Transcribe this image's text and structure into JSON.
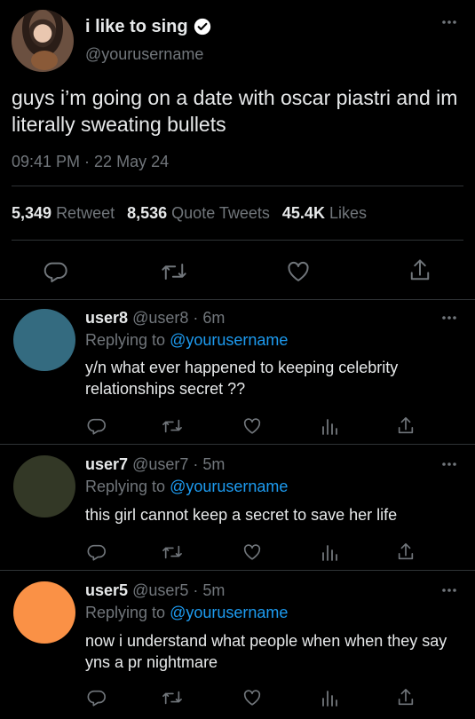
{
  "tweet": {
    "display_name": "i like to sing",
    "handle": "@yourusername",
    "text": "guys i’m going on a date with oscar piastri and im literally sweating bullets",
    "time": "09:41 PM",
    "separator": " · ",
    "date": "22 May 24",
    "stats": {
      "retweets_count": "5,349",
      "retweets_label": "Retweet",
      "quotes_count": "8,536",
      "quotes_label": "Quote Tweets",
      "likes_count": "45.4K",
      "likes_label": "Likes"
    }
  },
  "replies": [
    {
      "name": "user8",
      "handle": "@user8",
      "time": "6m",
      "replying_label": "Replying to",
      "replying_to": "@yourusername",
      "text": "y/n what ever happened to keeping celebrity relationships secret ??",
      "avatar_color": "#346b80"
    },
    {
      "name": "user7",
      "handle": "@user7",
      "time": "5m",
      "replying_label": "Replying to",
      "replying_to": "@yourusername",
      "text": "this girl cannot keep a secret to save her life",
      "avatar_color": "#333826"
    },
    {
      "name": "user5",
      "handle": "@user5",
      "time": "5m",
      "replying_label": "Replying to",
      "replying_to": "@yourusername",
      "text": "now i understand what people when when they say yns a pr nightmare",
      "avatar_color": "#fa9146"
    }
  ],
  "colors": {
    "accent": "#1d9bf0",
    "secondary_text": "#71767b",
    "divider": "#2f3336"
  }
}
